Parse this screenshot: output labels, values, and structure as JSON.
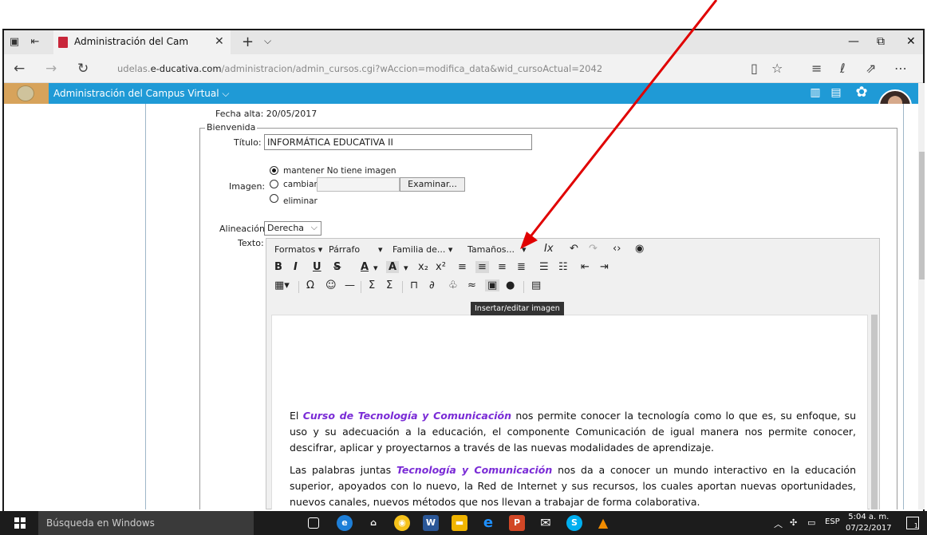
{
  "browser": {
    "tab_title": "Administración del Cam",
    "tab_close": "✕",
    "new_tab": "+",
    "tab_list": "⌵",
    "url_prefix": "udelas.",
    "url_domain": "e-ducativa.com",
    "url_path": "/administracion/admin_cursos.cgi?wAccion=modifica_data&wid_cursoActual=2042",
    "window_controls": {
      "minimize": "—",
      "restore": "⧉",
      "close": "✕"
    }
  },
  "app_header": {
    "title": "Administración del Campus Virtual",
    "title_chevron": "⌵",
    "accent_color": "#1f9ad6"
  },
  "form": {
    "fecha_alta": "Fecha alta: 20/05/2017",
    "legend": "Bienvenida",
    "titulo_label": "Título:",
    "titulo_value": "INFORMÁTICA EDUCATIVA II",
    "imagen_label": "Imagen:",
    "imagen_options": [
      "mantener No tiene imagen",
      "cambiar:",
      "eliminar"
    ],
    "imagen_selected": 0,
    "browse_button": "Examinar...",
    "alineacion_label": "Alineación:",
    "alineacion_value": "Derecha",
    "texto_label": "Texto:"
  },
  "editor": {
    "menu_formatos": "Formatos",
    "menu_parrafo": "Párrafo",
    "menu_familia": "Familia de...",
    "menu_tamanos": "Tamaños...",
    "tooltip": "Insertar/editar imagen",
    "paragraph1": {
      "lead": "El ",
      "highlight": "Curso de Tecnología y Comunicación",
      "rest": " nos permite conocer la tecnología como lo que es, su enfoque, su uso y su adecuación a la educación, el componente Comunicación de igual manera nos permite conocer, descifrar, aplicar y proyectarnos a través de las nuevas modalidades de aprendizaje."
    },
    "paragraph2": {
      "lead": "Las palabras juntas ",
      "highlight": "Tecnología y Comunicación",
      "rest": " nos da a conocer un mundo interactivo en la educación superior, apoyados con lo nuevo, la Red de Internet y sus recursos, los cuales aportan nuevas oportunidades,  nuevos canales, nuevos métodos que nos llevan a trabajar de forma colaborativa."
    },
    "highlight_color": "#7a2bd6"
  },
  "annotation": {
    "arrow_color": "#e00000"
  },
  "taskbar": {
    "search_placeholder": "Búsqueda en Windows",
    "language": "ESP",
    "time": "5:04 a. m.",
    "date": "07/22/2017"
  }
}
